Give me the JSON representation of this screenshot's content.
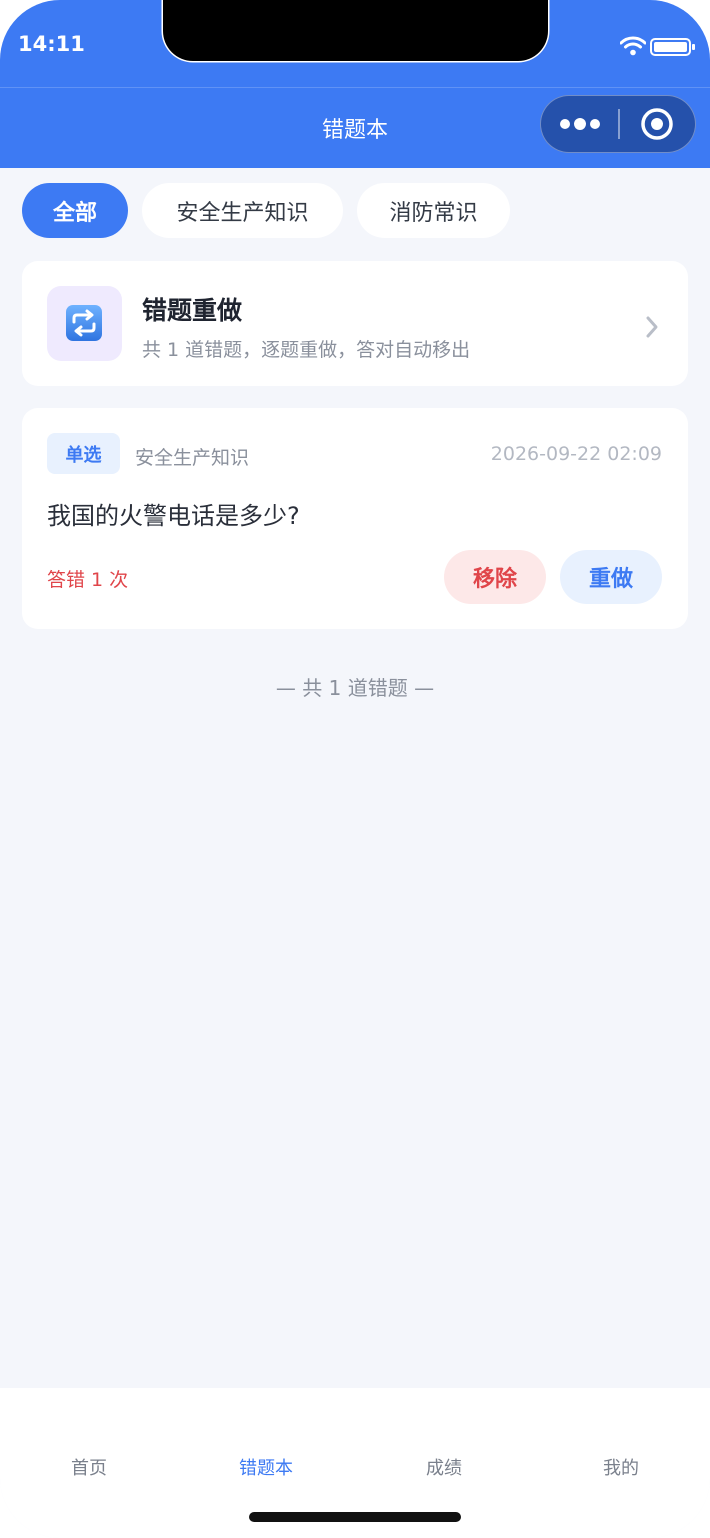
{
  "status_bar": {
    "time": "14:11"
  },
  "nav": {
    "title": "错题本"
  },
  "filter_tabs": [
    {
      "label": "全部",
      "active": true
    },
    {
      "label": "安全生产知识",
      "active": false
    },
    {
      "label": "消防常识",
      "active": false
    }
  ],
  "redo_card": {
    "icon": "repeat-icon",
    "title": "错题重做",
    "subtitle": "共 1 道错题，逐题重做，答对自动移出"
  },
  "question": {
    "type_badge": "单选",
    "category": "安全生产知识",
    "date": "2026-09-22 02:09",
    "text": "我国的火警电话是多少?",
    "wrong_count": "答错 1 次",
    "remove_label": "移除",
    "redo_label": "重做"
  },
  "footer": {
    "count_text": "— 共 1 道错题 —"
  },
  "tabbar": [
    {
      "label": "首页",
      "active": false
    },
    {
      "label": "错题本",
      "active": true
    },
    {
      "label": "成绩",
      "active": false
    },
    {
      "label": "我的",
      "active": false
    }
  ],
  "colors": {
    "primary": "#3d7af3",
    "danger": "#e0454a",
    "background": "#f4f6fb"
  }
}
